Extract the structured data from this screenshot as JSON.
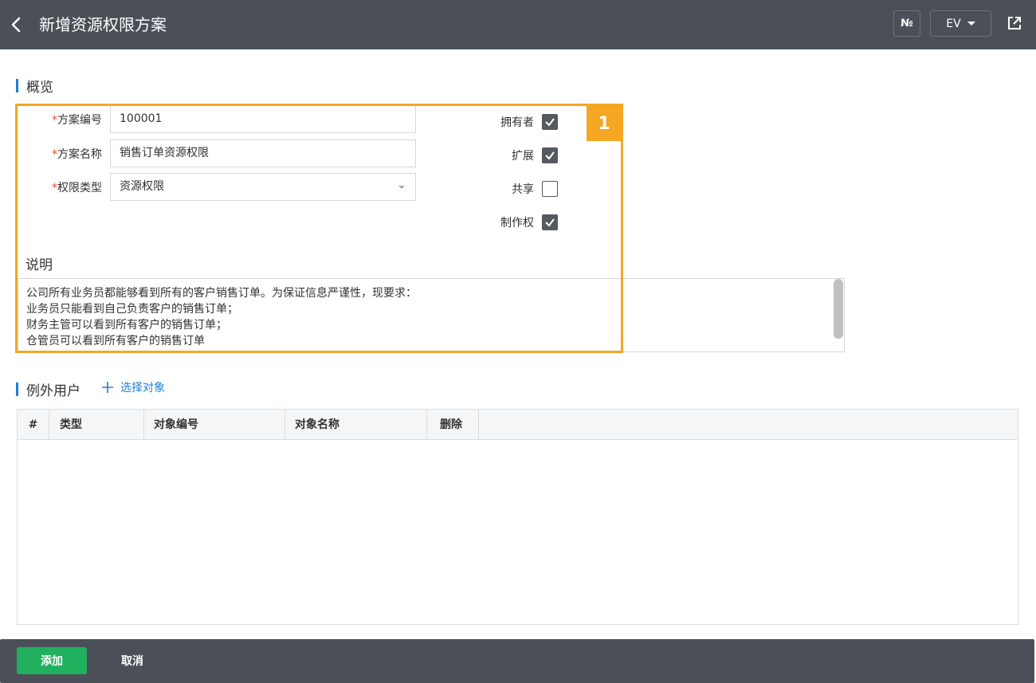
{
  "header": {
    "title": "新增资源权限方案",
    "no_button_label": "№",
    "lang_button_label": "EV"
  },
  "overview": {
    "section_title": "概览",
    "fields": [
      {
        "label": "方案编号",
        "value": "100001"
      },
      {
        "label": "方案名称",
        "value": "销售订单资源权限"
      },
      {
        "label": "权限类型",
        "value": "资源权限"
      }
    ],
    "checkboxes": [
      {
        "label": "拥有者",
        "checked": true
      },
      {
        "label": "扩展",
        "checked": true
      },
      {
        "label": "共享",
        "checked": false
      },
      {
        "label": "制作权",
        "checked": true
      }
    ],
    "badge": "1"
  },
  "description": {
    "section_title": "说明",
    "text": "公司所有业务员都能够看到所有的客户销售订单。为保证信息严谨性，现要求：\n业务员只能看到自己负责客户的销售订单；\n财务主管可以看到所有客户的销售订单；\n仓管员可以看到所有客户的销售订单"
  },
  "exceptions": {
    "section_title": "例外用户",
    "select_link": "选择对象",
    "columns": [
      "#",
      "类型",
      "对象编号",
      "对象名称",
      "删除"
    ]
  },
  "footer": {
    "add_label": "添加",
    "cancel_label": "取消"
  },
  "colors": {
    "topbar": "#4b5058",
    "accent": "#1f7ed8",
    "highlight": "#f5a623",
    "add_button": "#21b15e"
  }
}
